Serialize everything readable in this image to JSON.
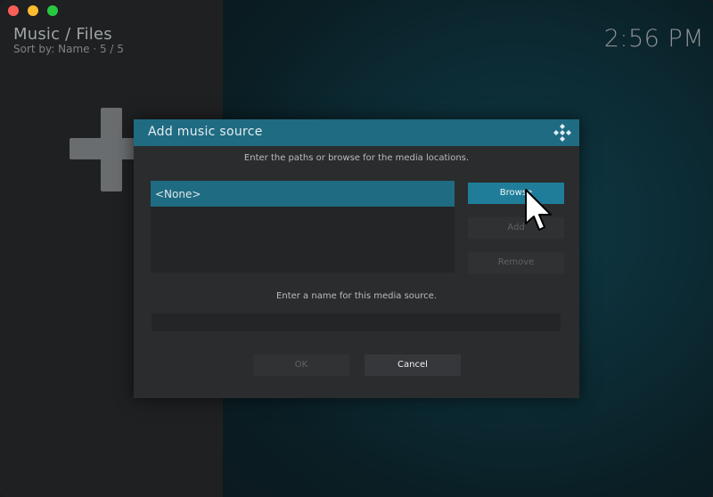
{
  "window": {
    "controls": [
      "close",
      "minimize",
      "maximize"
    ]
  },
  "header": {
    "title": "Music / Files",
    "sort": "Sort by: Name  ·  5 / 5",
    "clock": "2:56 PM"
  },
  "background": {
    "add_icon": "plus-icon"
  },
  "dialog": {
    "title": "Add music source",
    "logo_icon": "kodi-logo-icon",
    "instructions": "Enter the paths or browse for the media locations.",
    "paths": [
      {
        "label": "<None>",
        "selected": true
      }
    ],
    "buttons": {
      "browse": "Browse",
      "add": "Add",
      "remove": "Remove"
    },
    "name_prompt": "Enter a name for this media source.",
    "name_value": "",
    "ok": "OK",
    "cancel": "Cancel"
  },
  "colors": {
    "accent": "#1f6b82",
    "button_focus": "#1f7d99",
    "dialog_bg": "#2a2c2e"
  },
  "cursor_icon": "mouse-pointer-icon"
}
